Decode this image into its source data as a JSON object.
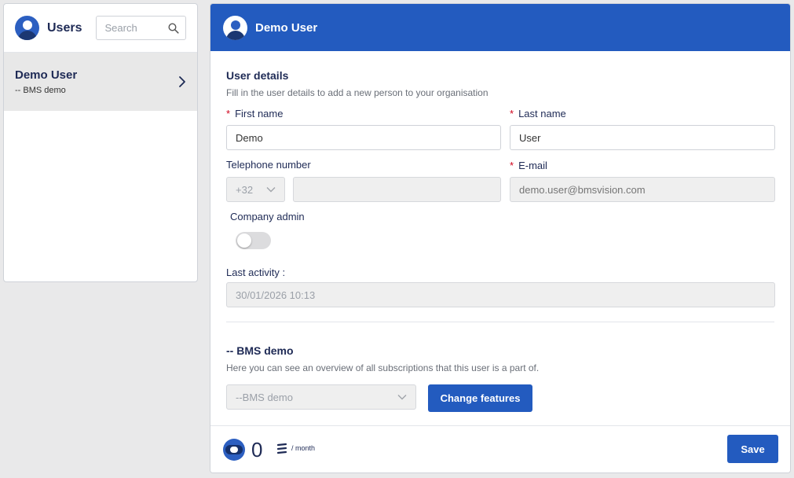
{
  "sidebar": {
    "title": "Users",
    "search_placeholder": "Search",
    "users": [
      {
        "name": "Demo User",
        "org": "-- BMS demo"
      }
    ]
  },
  "panel": {
    "title": "Demo User",
    "user_details": {
      "title": "User details",
      "subtitle": "Fill in the user details to add a new person to your organisation"
    },
    "fields": {
      "first_name_label": "First name",
      "first_name_value": "Demo",
      "last_name_label": "Last name",
      "last_name_value": "User",
      "telephone_label": "Telephone number",
      "country_code": "+32",
      "telephone_value": "",
      "email_label": "E-mail",
      "email_placeholder": "demo.user@bmsvision.com",
      "company_admin_label": "Company admin",
      "company_admin_on": false,
      "last_activity_label": "Last activity :",
      "last_activity_value": "30/01/2026 10:13"
    },
    "subscription": {
      "title": "-- BMS demo",
      "subtitle": "Here you can see an overview of all subscriptions that this user is a part of.",
      "select_value": "--BMS demo",
      "change_button": "Change features"
    },
    "footer": {
      "count": "0",
      "per_label": "/ month",
      "save_button": "Save"
    }
  },
  "colors": {
    "brand_blue": "#235bbf",
    "navy_text": "#1e2a55",
    "required_red": "#d0021b"
  }
}
